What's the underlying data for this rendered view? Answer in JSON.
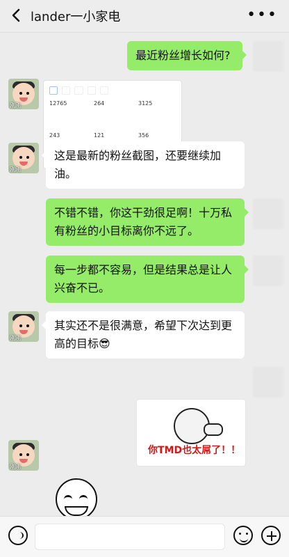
{
  "header": {
    "title": "lander一小家电",
    "back_icon": "chevron-left-icon",
    "more_icon": "more-dots-icon"
  },
  "messages": [
    {
      "side": "right",
      "text": "最近粉丝增长如何?"
    },
    {
      "side": "left",
      "screenshot": {
        "tabs": [
          " ",
          " ",
          " ",
          " ",
          " "
        ],
        "stats": [
          "12765",
          "264",
          "3125",
          "243",
          "121",
          "356"
        ]
      }
    },
    {
      "side": "left",
      "text": "这是最新的粉丝截图，还要继续加油。"
    },
    {
      "side": "right",
      "text": "不错不错，你这干劲很足啊！十万私有粉丝的小目标离你不远了。"
    },
    {
      "side": "right",
      "text": "每一步都不容易，但是结果总是让人兴奋不已。"
    },
    {
      "side": "left",
      "text": "其实还不是很满意，希望下次达到更高的目标😎"
    },
    {
      "side": "right",
      "sticker_caption": "你TMD也太屌了！！"
    },
    {
      "side": "left",
      "sticker": "grin-sticker"
    }
  ],
  "avatar_label": "刚刚",
  "bottom": {
    "voice_icon": "voice-icon",
    "emoji_icon": "smile-icon",
    "plus_icon": "plus-icon"
  },
  "colors": {
    "right_bubble": "#95ec69",
    "left_bubble": "#ffffff",
    "background": "#ececec"
  }
}
